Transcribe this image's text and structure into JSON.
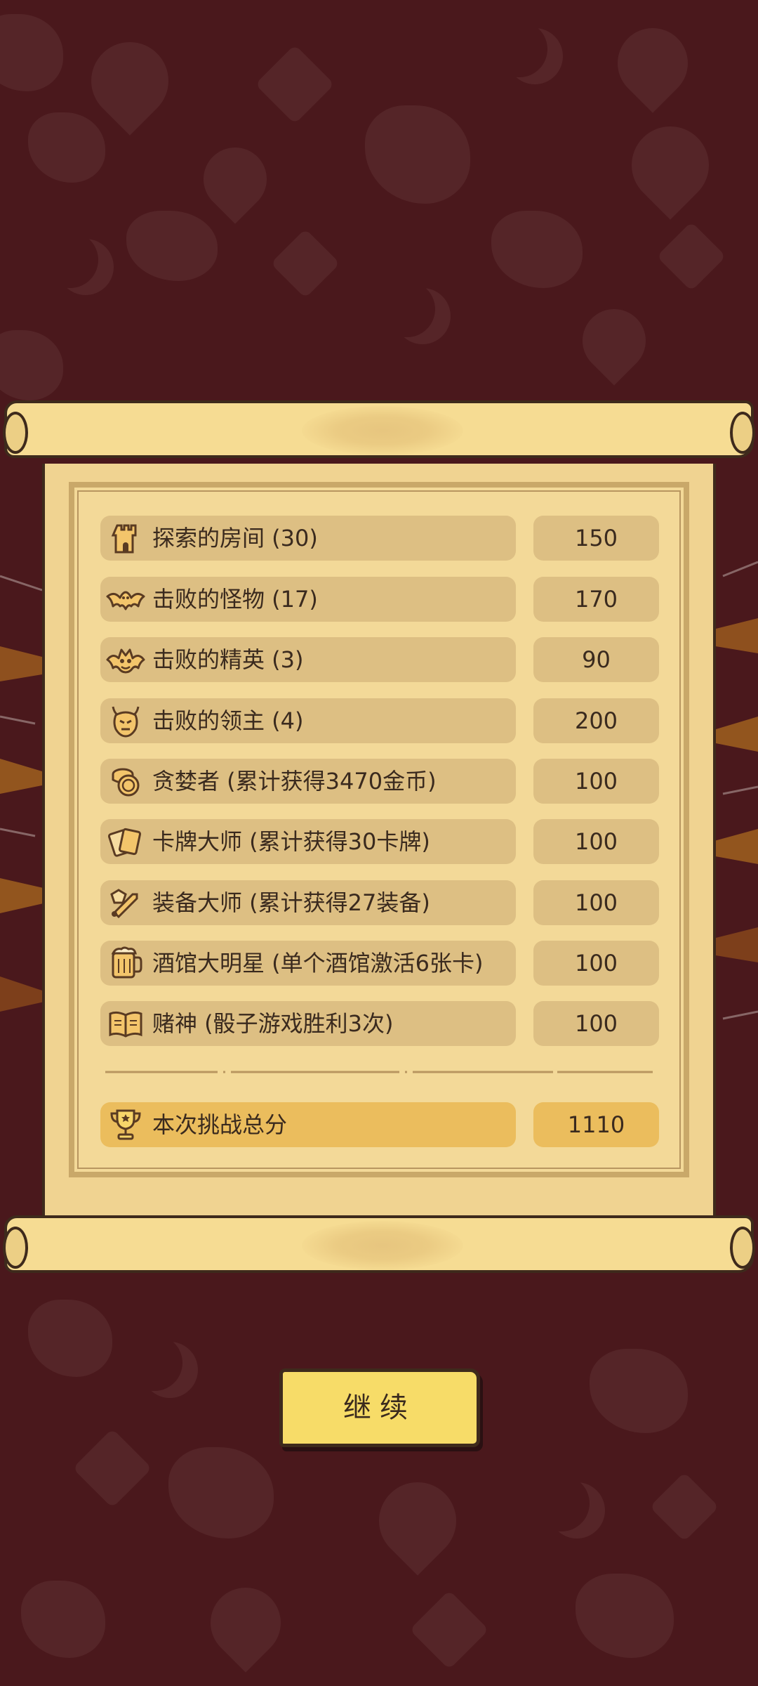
{
  "rows": [
    {
      "icon": "tower-icon",
      "label": "探索的房间 (30)",
      "value": "150"
    },
    {
      "icon": "bat-icon",
      "label": "击败的怪物 (17)",
      "value": "170"
    },
    {
      "icon": "elite-monster-icon",
      "label": "击败的精英 (3)",
      "value": "90"
    },
    {
      "icon": "boss-icon",
      "label": "击败的领主 (4)",
      "value": "200"
    },
    {
      "icon": "coins-icon",
      "label": "贪婪者 (累计获得3470金币)",
      "value": "100"
    },
    {
      "icon": "cards-icon",
      "label": "卡牌大师 (累计获得30卡牌)",
      "value": "100"
    },
    {
      "icon": "equipment-icon",
      "label": "装备大师 (累计获得27装备)",
      "value": "100"
    },
    {
      "icon": "tankard-icon",
      "label": "酒馆大明星 (单个酒馆激活6张卡)",
      "value": "100"
    },
    {
      "icon": "book-icon",
      "label": "赌神 (骰子游戏胜利3次)",
      "value": "100"
    }
  ],
  "total": {
    "icon": "trophy-icon",
    "label": "本次挑战总分",
    "value": "1110"
  },
  "continue_button": {
    "label": "继续"
  },
  "colors": {
    "background": "#4a181c",
    "parchment": "#f0d391",
    "pill": "#ddbf83",
    "total_pill": "#ebbd5d",
    "button": "#f7dc68",
    "text": "#3a2a1e"
  }
}
